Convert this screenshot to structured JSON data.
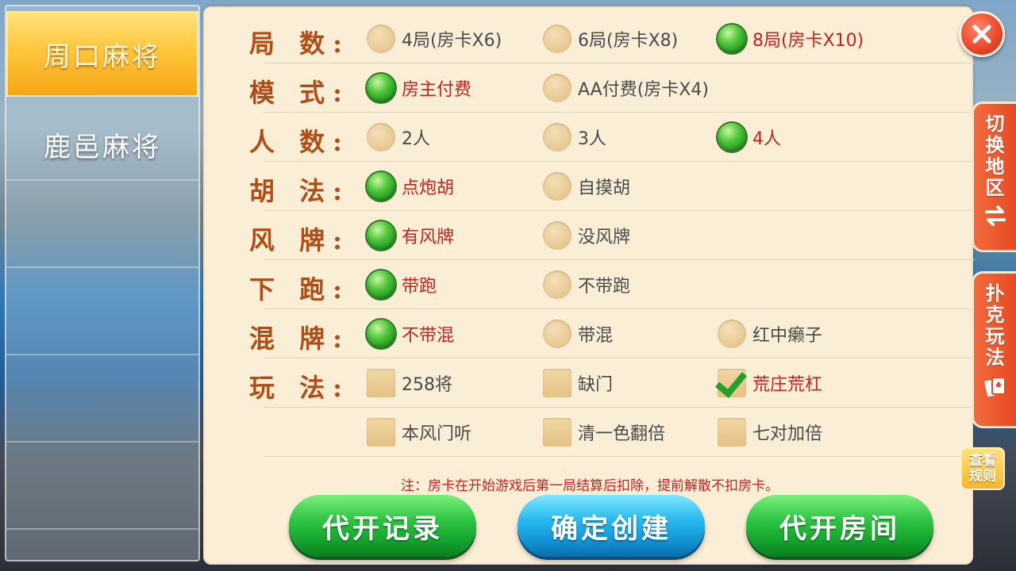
{
  "sidebar": {
    "items": [
      {
        "label": "周口麻将",
        "active": true
      },
      {
        "label": "鹿邑麻将",
        "active": false
      }
    ]
  },
  "options": [
    {
      "label": "局 数:",
      "type": "radio",
      "choices": [
        {
          "label": "4局(房卡X6)",
          "selected": false
        },
        {
          "label": "6局(房卡X8)",
          "selected": false
        },
        {
          "label": "8局(房卡X10)",
          "selected": true
        }
      ]
    },
    {
      "label": "模 式:",
      "type": "radio",
      "choices": [
        {
          "label": "房主付费",
          "selected": true
        },
        {
          "label": "AA付费(房卡X4)",
          "selected": false
        }
      ]
    },
    {
      "label": "人 数:",
      "type": "radio",
      "choices": [
        {
          "label": "2人",
          "selected": false
        },
        {
          "label": "3人",
          "selected": false
        },
        {
          "label": "4人",
          "selected": true
        }
      ]
    },
    {
      "label": "胡 法:",
      "type": "radio",
      "choices": [
        {
          "label": "点炮胡",
          "selected": true
        },
        {
          "label": "自摸胡",
          "selected": false
        }
      ]
    },
    {
      "label": "风 牌:",
      "type": "radio",
      "choices": [
        {
          "label": "有风牌",
          "selected": true
        },
        {
          "label": "没风牌",
          "selected": false
        }
      ]
    },
    {
      "label": "下 跑:",
      "type": "radio",
      "choices": [
        {
          "label": "带跑",
          "selected": true
        },
        {
          "label": "不带跑",
          "selected": false
        }
      ]
    },
    {
      "label": "混 牌:",
      "type": "radio",
      "choices": [
        {
          "label": "不带混",
          "selected": true
        },
        {
          "label": "带混",
          "selected": false
        },
        {
          "label": "红中癞子",
          "selected": false
        }
      ]
    },
    {
      "label": "玩 法:",
      "type": "checkbox",
      "choices": [
        {
          "label": "258将",
          "selected": false
        },
        {
          "label": "缺门",
          "selected": false
        },
        {
          "label": "荒庄荒杠",
          "selected": true
        }
      ]
    },
    {
      "label": "",
      "type": "checkbox",
      "choices": [
        {
          "label": "本风门听",
          "selected": false
        },
        {
          "label": "清一色翻倍",
          "selected": false
        },
        {
          "label": "七对加倍",
          "selected": false
        }
      ]
    }
  ],
  "note": "注：房卡在开始游戏后第一局结算后扣除，提前解散不扣房卡。",
  "buttons": {
    "records": "代开记录",
    "create": "确定创建",
    "proxy_room": "代开房间"
  },
  "side_tabs": {
    "region": {
      "chars": [
        "切",
        "换",
        "地",
        "区"
      ]
    },
    "poker": {
      "chars": [
        "扑",
        "克",
        "玩",
        "法"
      ]
    },
    "rules": {
      "lines": [
        "查看",
        "规则"
      ]
    }
  },
  "icons": {
    "close": "close-icon",
    "swap": "swap-arrows-icon",
    "cards": "playing-cards-icon"
  },
  "colors": {
    "label": "#b04d16",
    "selected_text": "#c0241f",
    "note": "#d21d1d",
    "green_button": "#14a32c",
    "blue_button": "#1293d4",
    "tab": "#e84a22"
  }
}
